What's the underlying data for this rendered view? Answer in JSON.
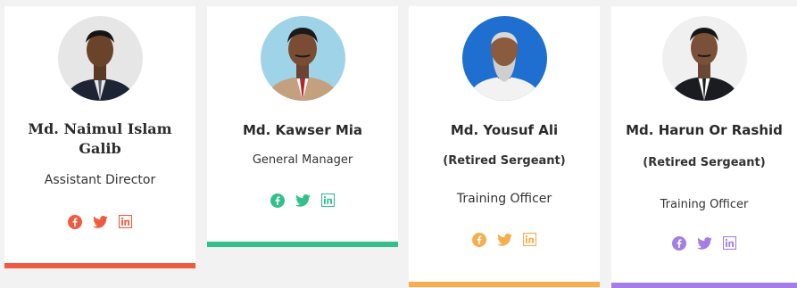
{
  "members": [
    {
      "name": "Md. Naimul Islam Galib",
      "subtitle": "",
      "role": "Assistant Director",
      "accent": "#f05a3e",
      "icons": [
        "facebook-icon",
        "twitter-icon",
        "linkedin-icon"
      ]
    },
    {
      "name": "Md. Kawser Mia",
      "subtitle": "",
      "role": "General Manager",
      "accent": "#33c08d",
      "icons": [
        "facebook-icon",
        "twitter-icon",
        "linkedin-icon"
      ]
    },
    {
      "name": "Md. Yousuf Ali",
      "subtitle": "(Retired Sergeant)",
      "role": "Training Officer",
      "accent": "#f7ad4d",
      "icons": [
        "facebook-icon",
        "twitter-icon",
        "linkedin-icon"
      ]
    },
    {
      "name": "Md. Harun Or Rashid",
      "subtitle": "(Retired Sergeant)",
      "role": "Training Officer",
      "accent": "#a47de6",
      "icons": [
        "facebook-icon",
        "twitter-icon",
        "linkedin-icon"
      ]
    }
  ]
}
